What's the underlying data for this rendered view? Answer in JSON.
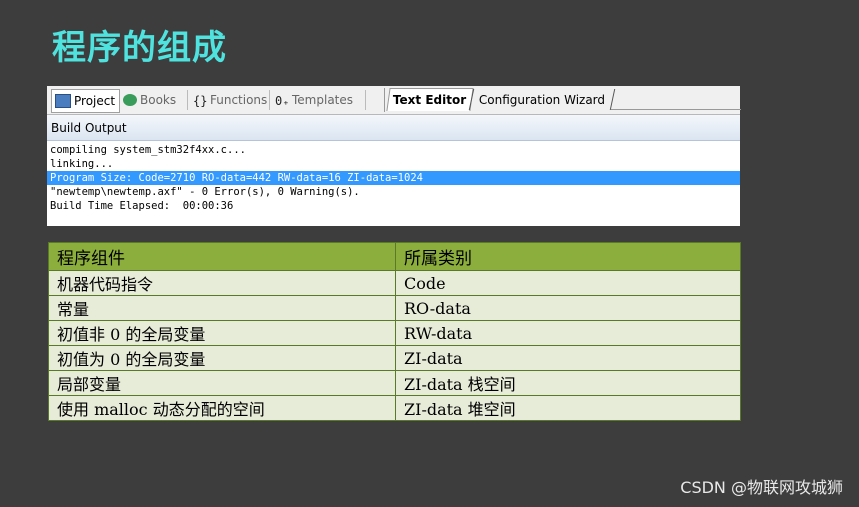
{
  "slide": {
    "title": "程序的组成"
  },
  "ide": {
    "tabs": {
      "project": "Project",
      "books": "Books",
      "functions": "Functions",
      "templates": "Templates",
      "text_editor": "Text Editor",
      "config_wizard": "Configuration Wizard"
    },
    "build_output_title": "Build Output",
    "output_lines": [
      "compiling system_stm32f4xx.c...",
      "linking...",
      "Program Size: Code=2710 RO-data=442 RW-data=16 ZI-data=1024",
      "\"newtemp\\newtemp.axf\" - 0 Error(s), 0 Warning(s).",
      "Build Time Elapsed:  00:00:36"
    ]
  },
  "table": {
    "headers": [
      "程序组件",
      "所属类别"
    ],
    "rows": [
      [
        "机器代码指令",
        "Code"
      ],
      [
        "常量",
        "RO-data"
      ],
      [
        "初值非 0 的全局变量",
        "RW-data"
      ],
      [
        "初值为 0 的全局变量",
        "ZI-data"
      ],
      [
        "局部变量",
        "ZI-data 栈空间"
      ],
      [
        "使用 malloc 动态分配的空间",
        "ZI-data 堆空间"
      ]
    ]
  },
  "watermark": "CSDN @物联网攻城狮"
}
